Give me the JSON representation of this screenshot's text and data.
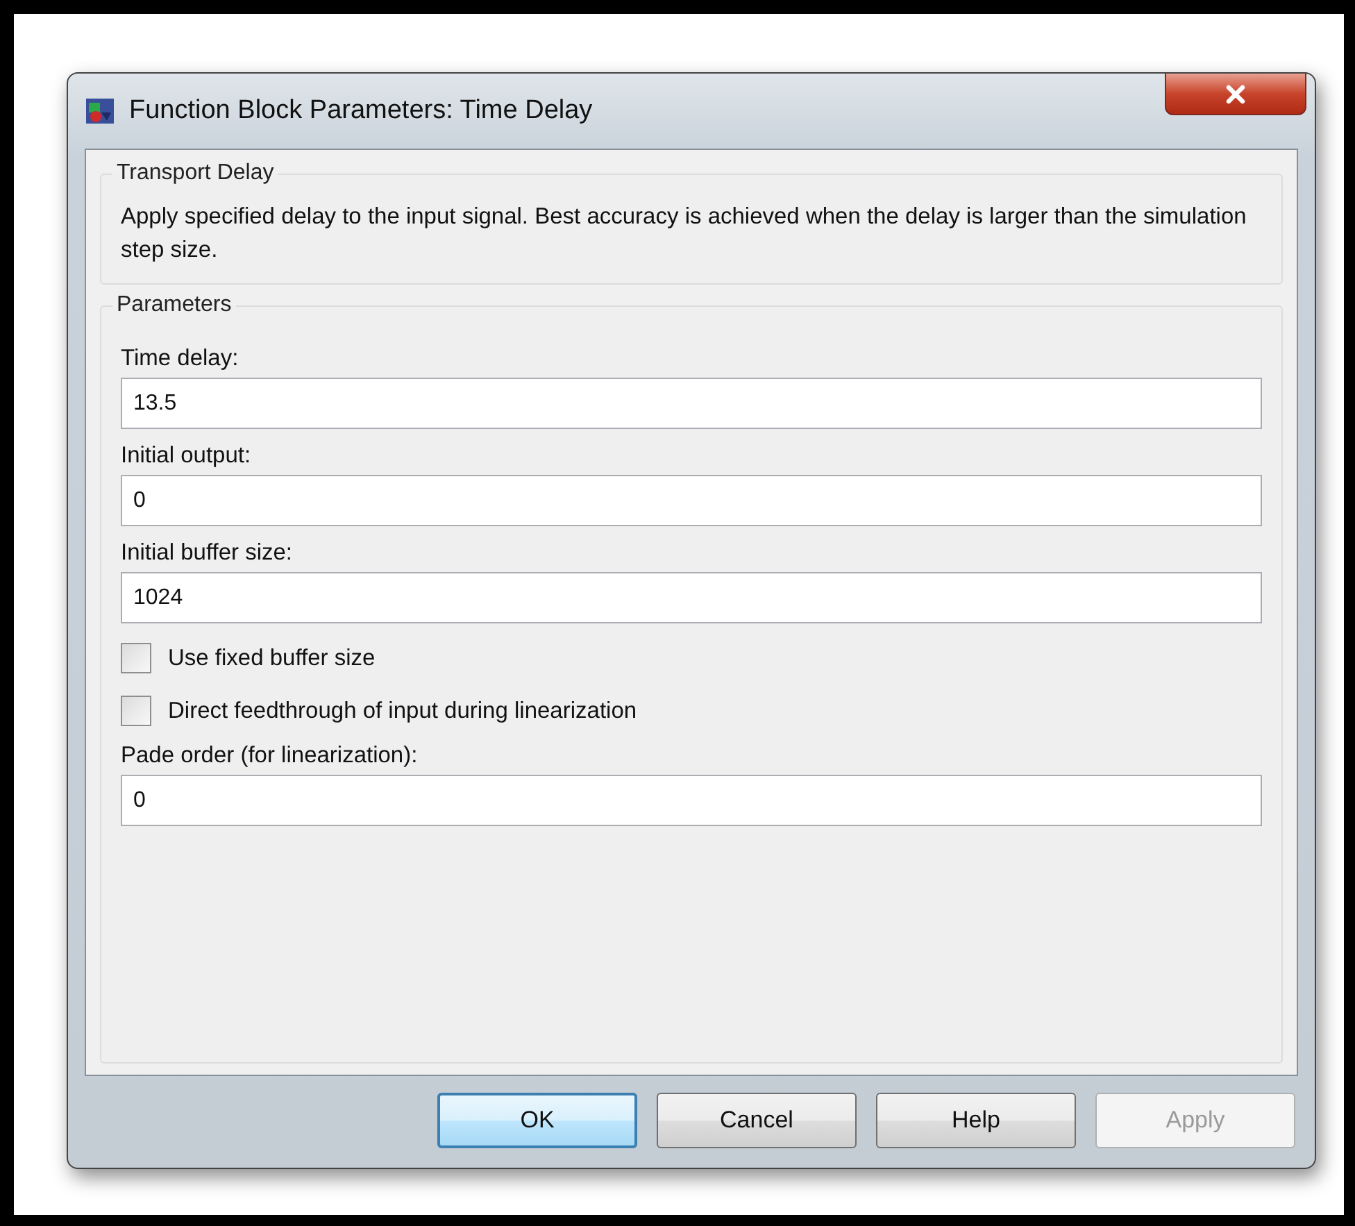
{
  "window": {
    "title": "Function Block Parameters: Time Delay"
  },
  "description_group": {
    "title": "Transport Delay",
    "text": "Apply specified delay to the input signal.  Best accuracy is achieved when the delay is larger than the simulation step size."
  },
  "parameters_group": {
    "title": "Parameters",
    "items": [
      {
        "kind": "field",
        "label": "Time delay:",
        "value": "13.5"
      },
      {
        "kind": "field",
        "label": "Initial output:",
        "value": "0"
      },
      {
        "kind": "field",
        "label": "Initial buffer size:",
        "value": "1024"
      },
      {
        "kind": "checkbox",
        "label": "Use fixed buffer size",
        "checked": false
      },
      {
        "kind": "checkbox",
        "label": "Direct feedthrough of input during linearization",
        "checked": false
      },
      {
        "kind": "field",
        "label": "Pade order (for linearization):",
        "value": "0"
      }
    ]
  },
  "buttons": [
    {
      "label": "OK",
      "default": true,
      "disabled": false
    },
    {
      "label": "Cancel",
      "default": false,
      "disabled": false
    },
    {
      "label": "Help",
      "default": false,
      "disabled": false
    },
    {
      "label": "Apply",
      "default": false,
      "disabled": true
    }
  ]
}
